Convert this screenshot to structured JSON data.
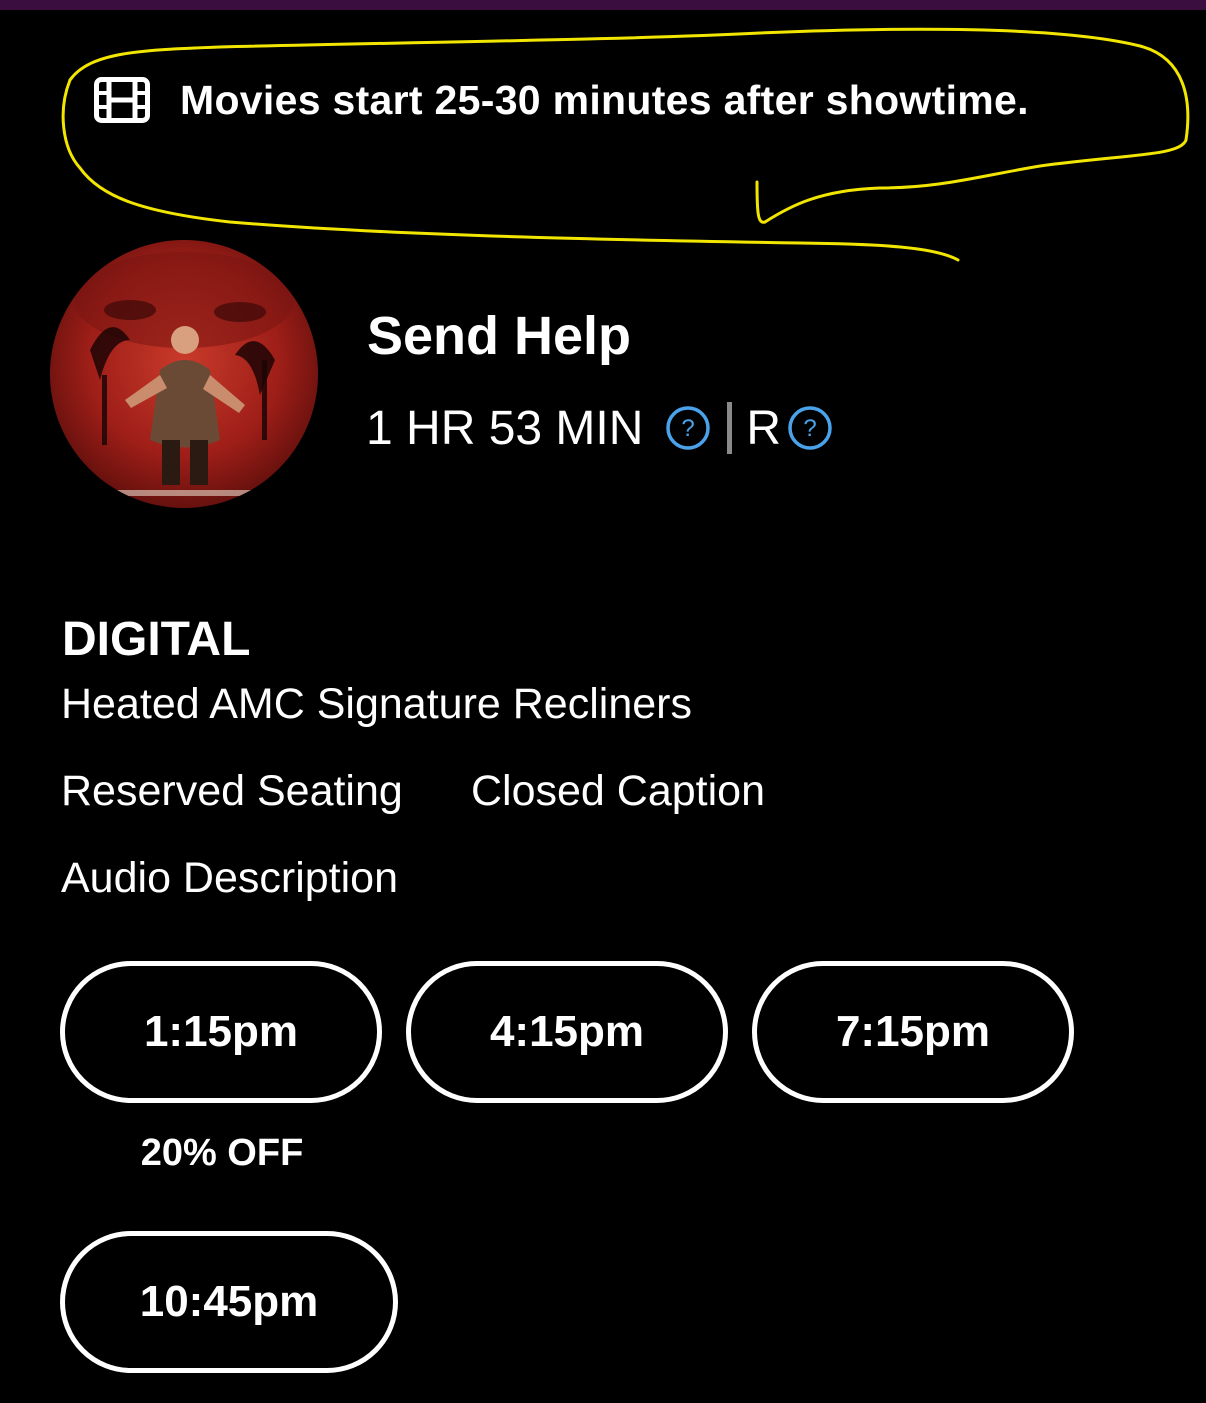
{
  "notice": {
    "icon": "film-icon",
    "text": "Movies start 25-30 minutes after showtime."
  },
  "annotation": {
    "color": "#f2e600"
  },
  "movie": {
    "title": "Send Help",
    "runtime": "1 HR 53 MIN",
    "rating": "R"
  },
  "format": {
    "title": "DIGITAL",
    "amenities": [
      "Heated AMC Signature Recliners",
      "Reserved Seating",
      "Closed Caption",
      "Audio Description"
    ]
  },
  "showtimes": [
    {
      "time": "1:15pm",
      "badge": "20% OFF"
    },
    {
      "time": "4:15pm"
    },
    {
      "time": "7:15pm"
    },
    {
      "time": "10:45pm"
    }
  ],
  "colors": {
    "background": "#000000",
    "top_bar": "#3a0f3f",
    "help_icon": "#4aa3ea",
    "text": "#ffffff"
  }
}
